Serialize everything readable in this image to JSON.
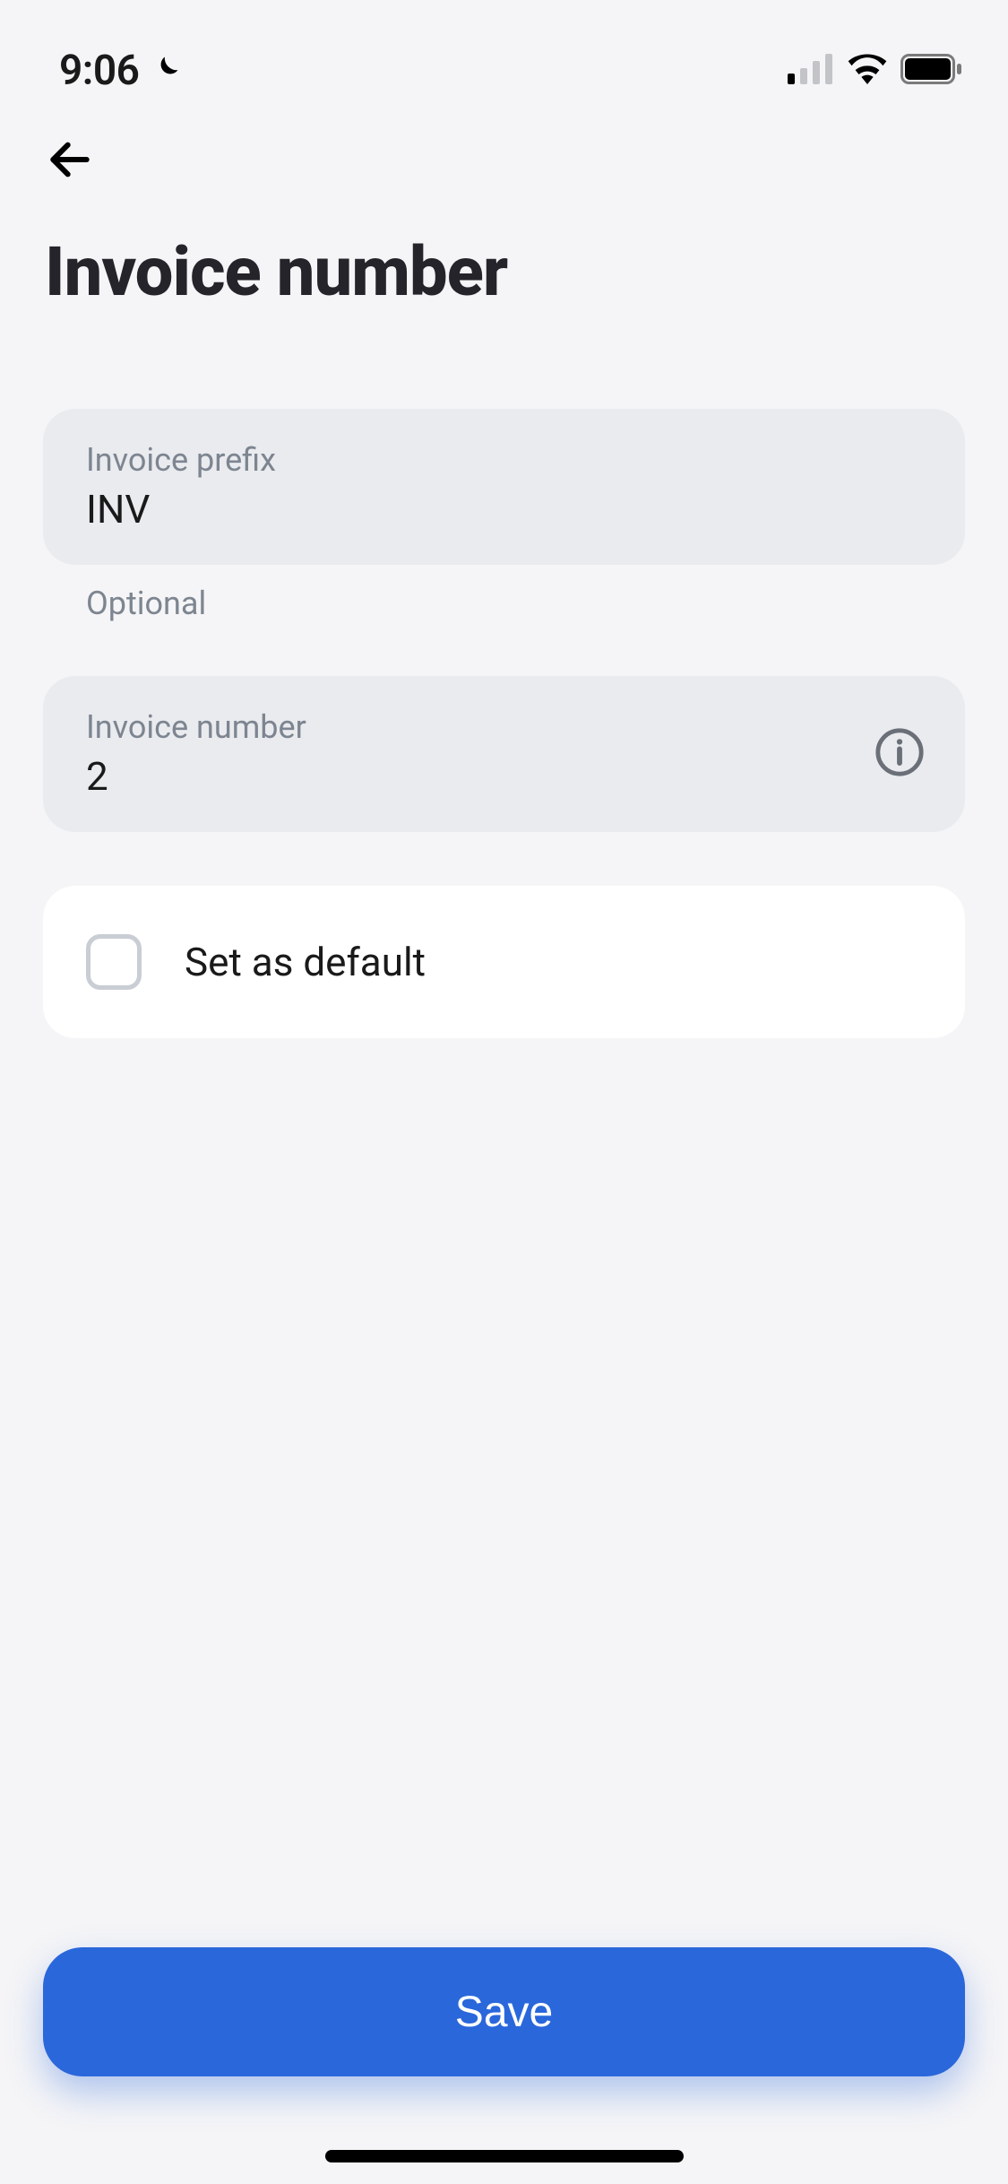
{
  "status": {
    "time": "9:06",
    "moon_icon": "moon-icon",
    "cellular_icon": "cellular-signal-icon",
    "wifi_icon": "wifi-icon",
    "battery_icon": "battery-icon"
  },
  "header": {
    "back_icon": "back-arrow-icon",
    "title": "Invoice number"
  },
  "fields": {
    "prefix": {
      "label": "Invoice prefix",
      "value": "INV",
      "helper": "Optional"
    },
    "number": {
      "label": "Invoice number",
      "value": "2",
      "info_icon": "info-icon"
    }
  },
  "default": {
    "checked": false,
    "label": "Set as default"
  },
  "actions": {
    "save_label": "Save"
  }
}
